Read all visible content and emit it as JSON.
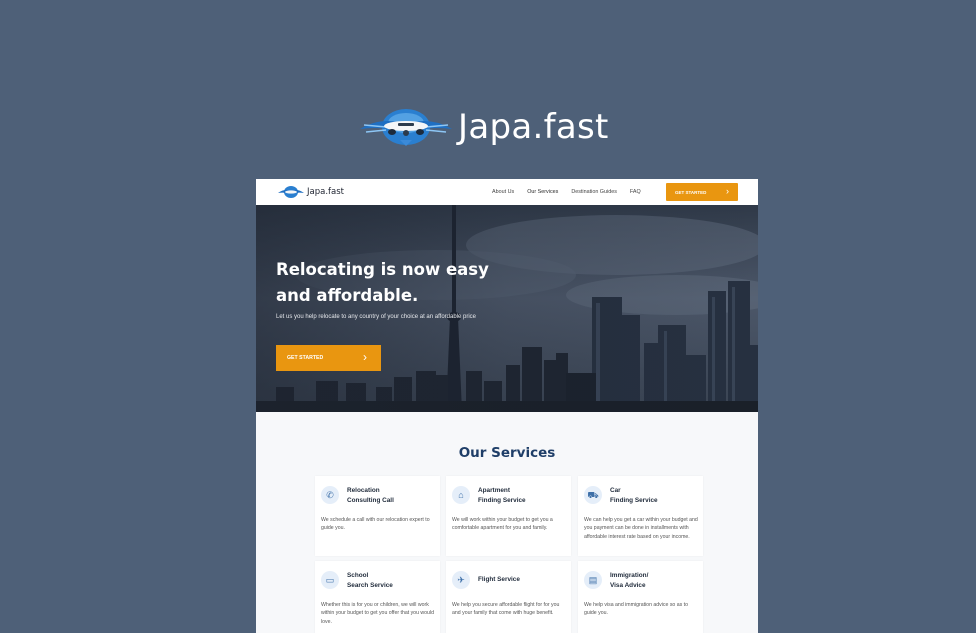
{
  "brand": {
    "name": "Japa.fast",
    "logo_icon": "airplane-logo-icon"
  },
  "site": {
    "nav": {
      "brand": "Japa.fast",
      "links": [
        "About Us",
        "Our Services",
        "Destination Guides",
        "FAQ"
      ],
      "cta": "GET STARTED"
    },
    "hero": {
      "title_line1": "Relocating is now easy",
      "title_line2": "and affordable.",
      "subtitle": "Let us you help relocate to any country of your choice at an affordable price",
      "cta": "GET STARTED"
    },
    "services": {
      "title": "Our Services",
      "cards": [
        {
          "title_line1": "Relocation",
          "title_line2": "Consulting Call",
          "desc": "We schedule a call with our relocation expert to guide you.",
          "icon": "phone-icon"
        },
        {
          "title_line1": "Apartment",
          "title_line2": "Finding Service",
          "desc": "We will work within your budget to get you a comfortable apartment for you and family.",
          "icon": "house-search-icon"
        },
        {
          "title_line1": "Car",
          "title_line2": "Finding Service",
          "desc": "We can help you get a car within your budget and you payment can be done in installments with affordable interest rate based on your income.",
          "icon": "car-icon"
        },
        {
          "title_line1": "School",
          "title_line2": "Search Service",
          "desc": "Whether this is for you or children, we will work within your budget to get you offer that you would love.",
          "icon": "book-icon"
        },
        {
          "title_line1": "Flight Service",
          "title_line2": "",
          "desc": "We help you secure affordable flight for for you and your family that come with huge benefit.",
          "icon": "plane-icon"
        },
        {
          "title_line1": "Immigration/",
          "title_line2": "Visa Advice",
          "desc": "We help visa and immigration advice so as to guide you.",
          "icon": "document-icon"
        }
      ]
    }
  },
  "colors": {
    "background": "#4e6078",
    "accent": "#e99610",
    "heading": "#1f3e68"
  }
}
